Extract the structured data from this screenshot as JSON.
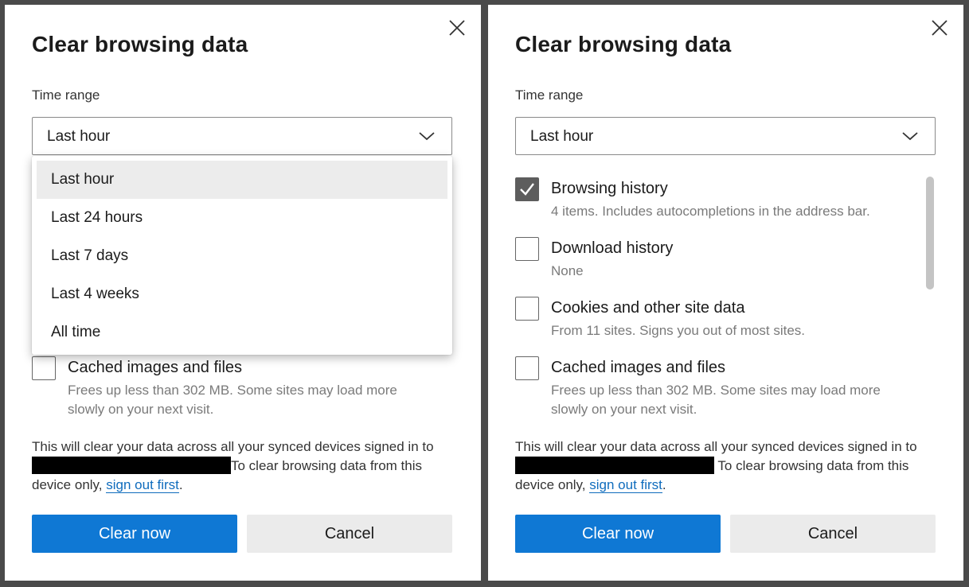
{
  "dialog": {
    "title": "Clear browsing data",
    "time_range_label": "Time range",
    "selected_range": "Last hour",
    "range_options": [
      "Last hour",
      "Last 24 hours",
      "Last 7 days",
      "Last 4 weeks",
      "All time"
    ],
    "items": [
      {
        "label": "Browsing history",
        "desc": "4 items. Includes autocompletions in the address bar."
      },
      {
        "label": "Download history",
        "desc": "None"
      },
      {
        "label": "Cookies and other site data",
        "desc": "From 11 sites. Signs you out of most sites."
      },
      {
        "label": "Cached images and files",
        "desc": "Frees up less than 302 MB. Some sites may load more slowly on your next visit."
      }
    ],
    "sync_text_a": "This will clear your data across all your synced devices signed in to",
    "sync_text_b": "To clear browsing data from this device only,",
    "sign_out_link": "sign out first",
    "sync_text_end": ".",
    "clear_button": "Clear now",
    "cancel_button": "Cancel"
  },
  "colors": {
    "primary": "#0f78d4",
    "link": "#0f6cbd",
    "checkbox_checked": "#5d5d5d"
  },
  "icons": {
    "close": "close-icon",
    "dropdown": "chevron-down-icon",
    "check": "checkmark-icon"
  }
}
